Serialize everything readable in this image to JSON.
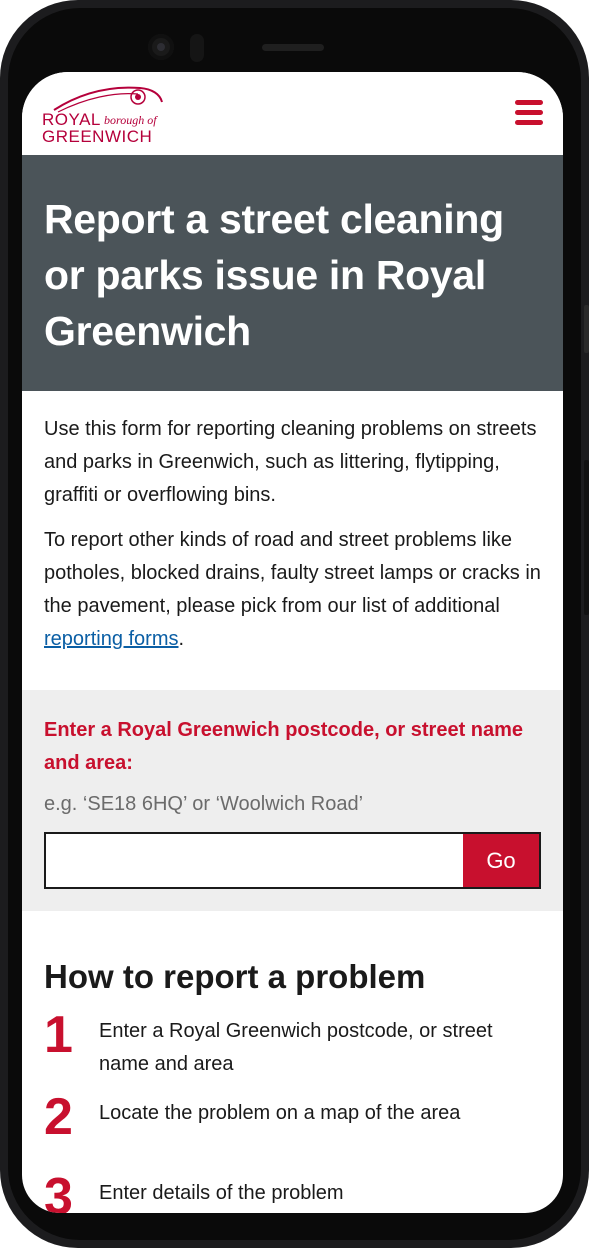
{
  "header": {
    "logo": {
      "line1": "ROYAL",
      "line1_sub": "borough of",
      "line2": "GREENWICH"
    },
    "menu_icon": "hamburger-menu-icon"
  },
  "hero": {
    "title": "Report a street cleaning or parks issue in Royal Greenwich"
  },
  "intro": {
    "para1": "Use this form for reporting cleaning problems on streets and parks in Greenwich, such as littering, flytipping, graffiti or overflowing bins.",
    "para2_before": "To report other kinds of road and street problems like potholes, blocked drains, faulty street lamps or cracks in the pavement, please pick from our list of additional ",
    "para2_link": "reporting forms",
    "para2_after": "."
  },
  "postcode_form": {
    "label": "Enter a Royal Greenwich postcode, or street name and area:",
    "hint": "e.g. ‘SE18 6HQ’ or ‘Woolwich Road’",
    "input_value": "",
    "go_label": "Go"
  },
  "how_to": {
    "heading": "How to report a problem",
    "steps": [
      {
        "number": "1",
        "text": "Enter a Royal Greenwich postcode, or street name and area"
      },
      {
        "number": "2",
        "text": "Locate the problem on a map of the area"
      },
      {
        "number": "3",
        "text": "Enter details of the problem"
      }
    ]
  },
  "colors": {
    "brand_red": "#c8102e",
    "hero_bg": "#4b5459",
    "form_bg": "#eeeeee",
    "link": "#0b5fa5"
  }
}
